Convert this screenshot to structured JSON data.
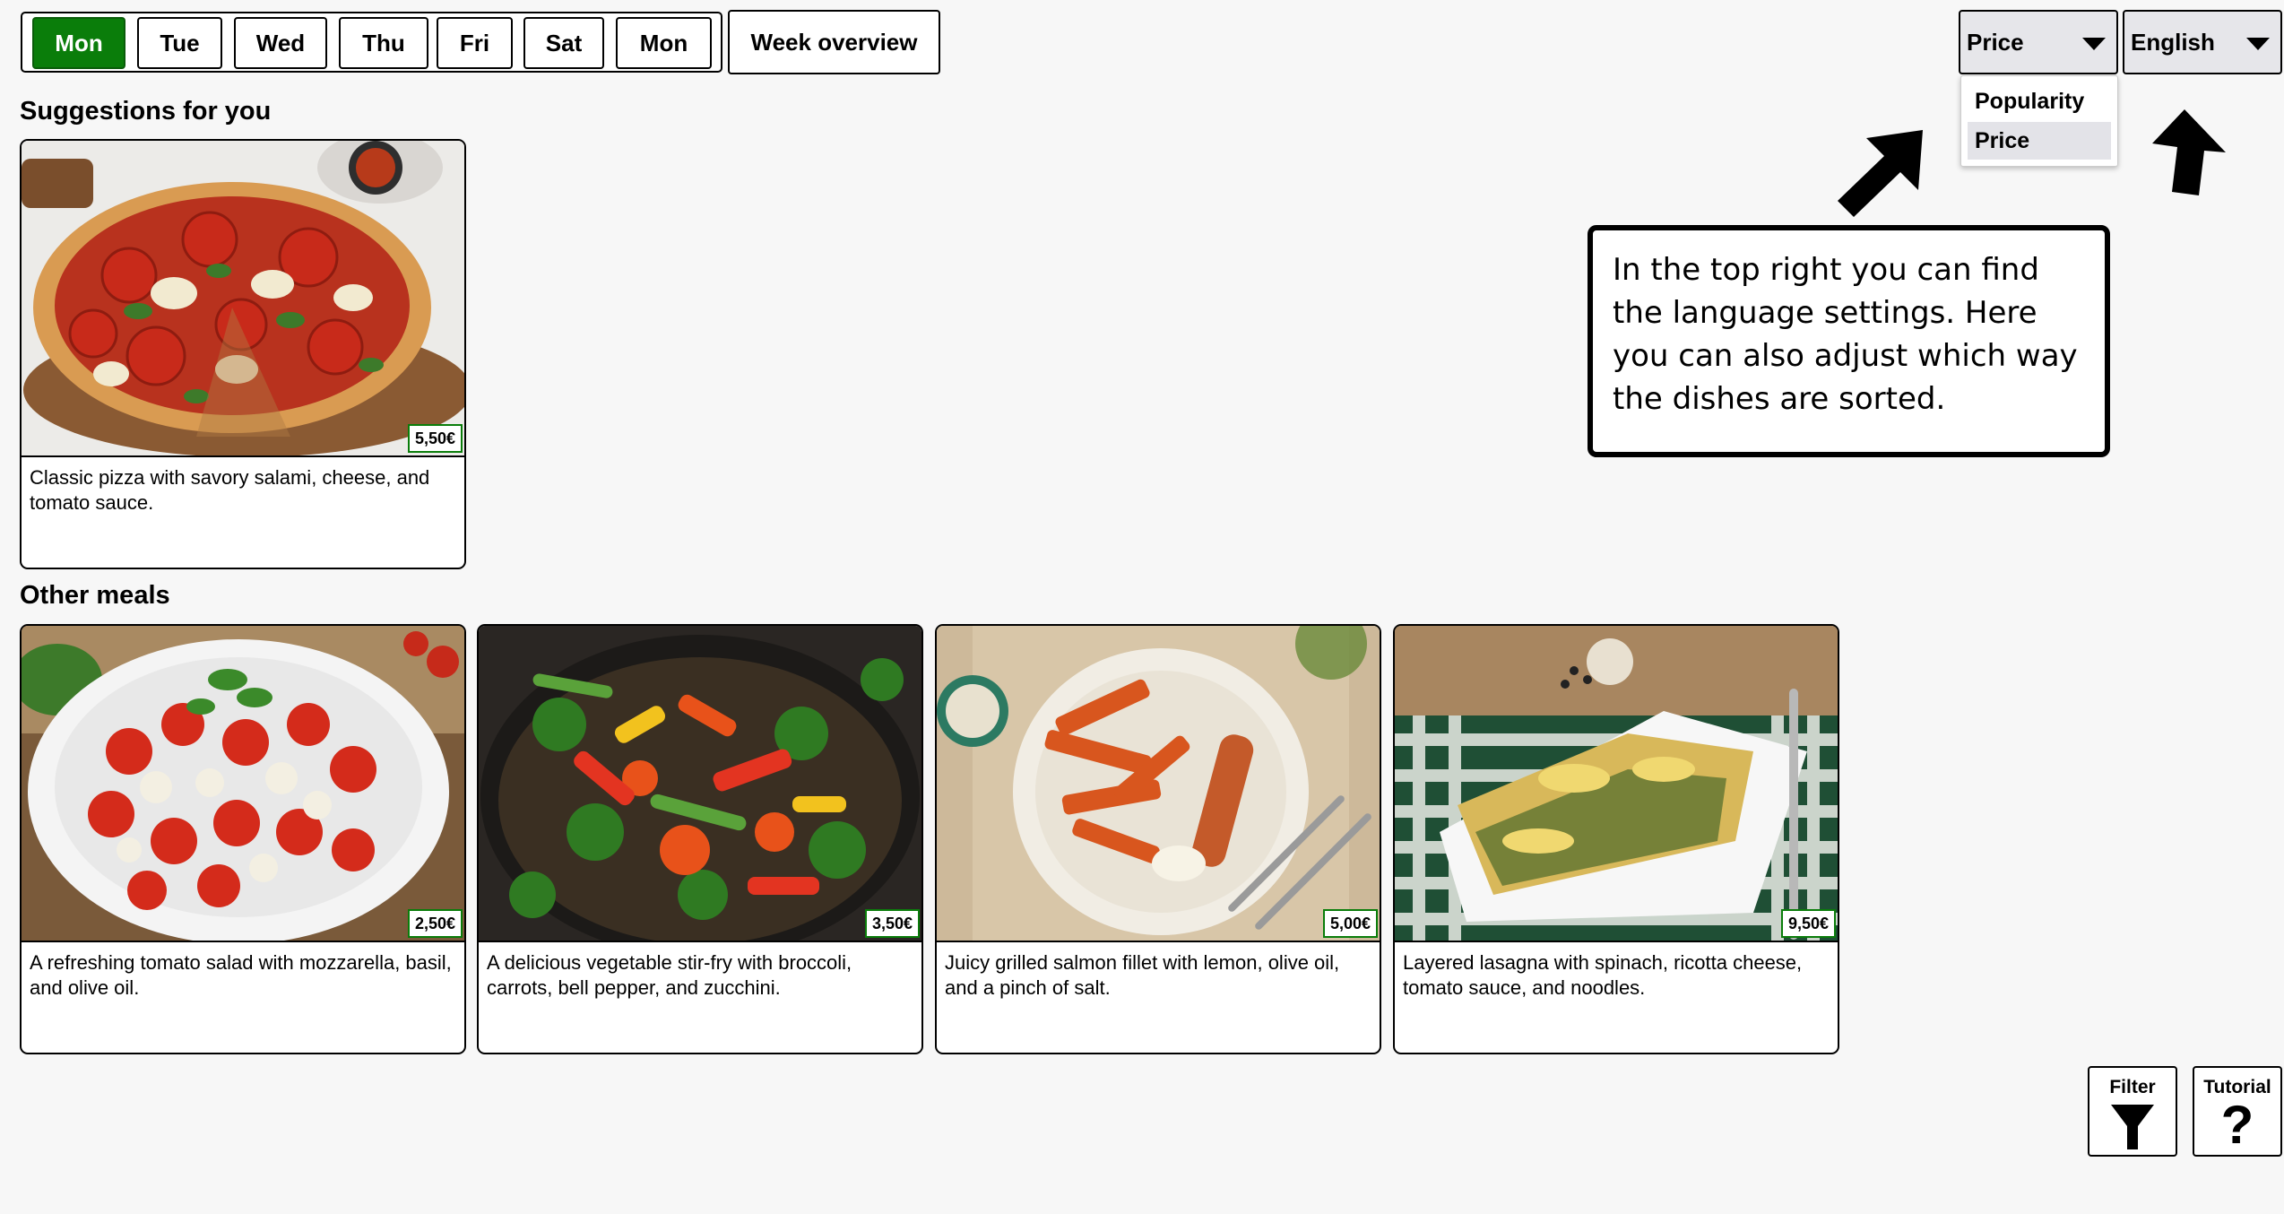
{
  "days": [
    "Mon",
    "Tue",
    "Wed",
    "Thu",
    "Fri",
    "Sat",
    "Mon"
  ],
  "active_day_index": 0,
  "week_overview_label": "Week overview",
  "sort": {
    "selected": "Price",
    "options": [
      "Popularity",
      "Price"
    ]
  },
  "language": {
    "selected": "English"
  },
  "tooltip_text": "In the top right you can find the language settings. Here you can also adjust which way the dishes are sorted.",
  "suggestions": {
    "title": "Suggestions for you",
    "items": [
      {
        "price": "5,50€",
        "description": "Classic pizza with savory salami, cheese, and tomato sauce."
      }
    ]
  },
  "other": {
    "title": "Other meals",
    "items": [
      {
        "price": "2,50€",
        "description": "A refreshing tomato salad with mozzarella, basil, and olive oil."
      },
      {
        "price": "3,50€",
        "description": "A delicious vegetable stir-fry with broccoli, carrots, bell pepper, and zucchini."
      },
      {
        "price": "5,00€",
        "description": "Juicy grilled salmon fillet with lemon, olive oil, and a pinch of salt."
      },
      {
        "price": "9,50€",
        "description": "Layered lasagna with spinach, ricotta cheese, tomato sauce, and noodles."
      }
    ]
  },
  "buttons": {
    "filter": "Filter",
    "tutorial": "Tutorial"
  },
  "colors": {
    "accent": "#0a7d0a",
    "dropdown_bg": "#e6e6ea"
  }
}
